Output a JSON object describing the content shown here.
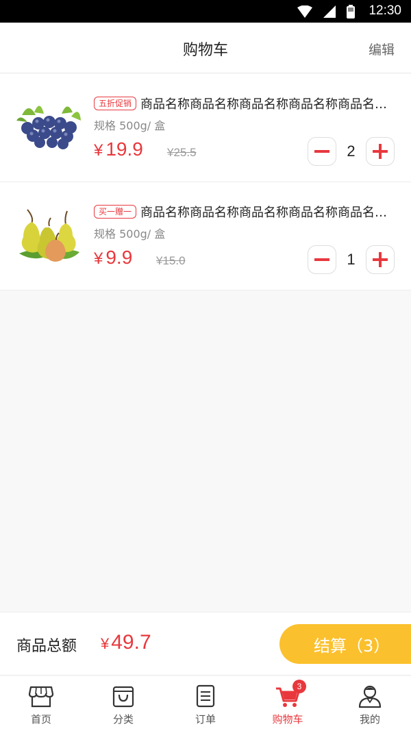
{
  "status_bar": {
    "time": "12:30"
  },
  "header": {
    "title": "购物车",
    "edit_label": "编辑"
  },
  "cart_items": [
    {
      "image": "blueberries",
      "promo_tag": "五折促销",
      "name": "商品名称商品名称商品名称商品名称商品名称商品名称",
      "spec": "规格 500g/ 盒",
      "currency": "¥",
      "price": "19.9",
      "original_price": "¥25.5",
      "quantity": "2"
    },
    {
      "image": "pears",
      "promo_tag": "买一赠一",
      "name": "商品名称商品名称商品名称商品名称商品名称商品名称",
      "spec": "规格 500g/ 盒",
      "currency": "¥",
      "price": "9.9",
      "original_price": "¥15.0",
      "quantity": "1"
    }
  ],
  "checkout": {
    "total_label": "商品总额",
    "currency": "¥",
    "total_value": "49.7",
    "button_label": "结算（3）"
  },
  "tabs": [
    {
      "label": "首页",
      "icon": "store-icon",
      "active": false
    },
    {
      "label": "分类",
      "icon": "bag-icon",
      "active": false
    },
    {
      "label": "订单",
      "icon": "order-list-icon",
      "active": false
    },
    {
      "label": "购物车",
      "icon": "cart-icon",
      "active": true,
      "badge": "3"
    },
    {
      "label": "我的",
      "icon": "user-icon",
      "active": false
    }
  ],
  "colors": {
    "accent": "#e8383d",
    "checkout_button": "#fbc02d"
  }
}
